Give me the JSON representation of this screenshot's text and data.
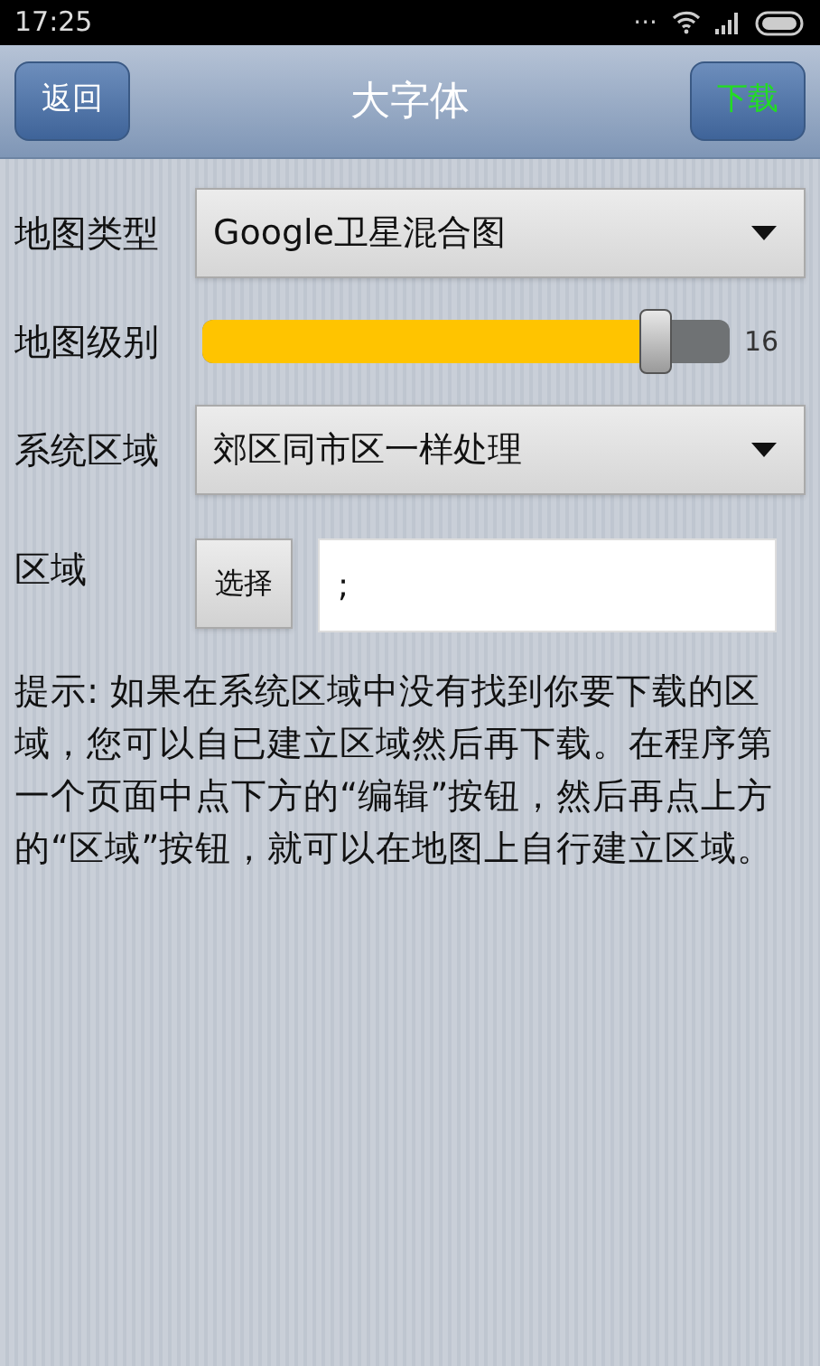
{
  "status_bar": {
    "time": "17:25",
    "dots": "..."
  },
  "header": {
    "back": "返回",
    "title": "大字体",
    "action": "下载"
  },
  "map_type": {
    "label": "地图类型",
    "value": "Google卫星混合图"
  },
  "map_level": {
    "label": "地图级别",
    "level": 0.86,
    "reading": "16"
  },
  "system_area": {
    "label": "系统区域",
    "value": "郊区同市区一样处理"
  },
  "area": {
    "label": "区域",
    "button": "选择",
    "value": ";"
  },
  "hint": "提示: 如果在系统区域中没有找到你要下载的区域，您可以自已建立区域然后再下载。在程序第一个页面中点下方的“编辑”按钮，然后再点上方的“区域”按钮，就可以在地图上自行建立区域。"
}
